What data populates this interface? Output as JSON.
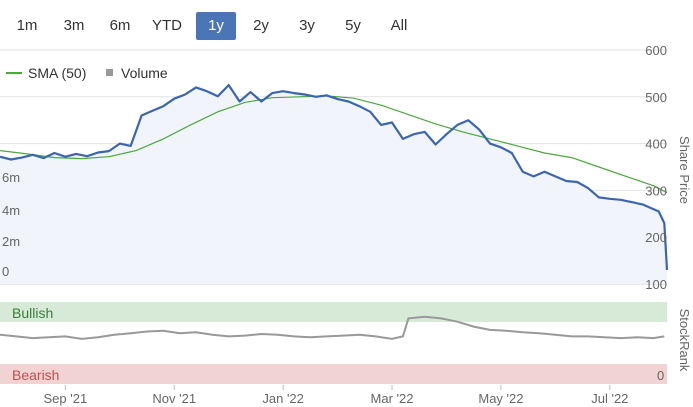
{
  "range_buttons": [
    {
      "label": "1m",
      "active": false
    },
    {
      "label": "3m",
      "active": false
    },
    {
      "label": "6m",
      "active": false
    },
    {
      "label": "YTD",
      "active": false
    },
    {
      "label": "1y",
      "active": true
    },
    {
      "label": "2y",
      "active": false
    },
    {
      "label": "3y",
      "active": false
    },
    {
      "label": "5y",
      "active": false
    },
    {
      "label": "All",
      "active": false
    }
  ],
  "colors": {
    "price": "#3a66b0",
    "price_fill": "#f1f4fa",
    "sma": "#4aa83c",
    "volume": "#c4c4c4",
    "stockrank": "#999999",
    "bullish_band": "#d7ead7",
    "bearish_band": "#f2d3d3",
    "active_button": "#4a76b8"
  },
  "chart_data": [
    {
      "type": "line",
      "title": "",
      "y_right_label": "Share Price",
      "y_right_ticks": [
        600,
        500,
        400,
        300,
        200,
        100
      ],
      "y_left_label": "",
      "y_left_ticks": [
        "0",
        "2m",
        "4m",
        "6m"
      ],
      "ylim": [
        100,
        600
      ],
      "x_ticks": [
        "Sep '21",
        "Nov '21",
        "Jan '22",
        "Mar '22",
        "May '22",
        "Jul '22"
      ],
      "x_tick_positions": [
        1.2,
        3.2,
        5.2,
        7.2,
        9.2,
        11.2
      ],
      "xlim": [
        0,
        12.25
      ],
      "grid": true,
      "legend": {
        "placement": "top-left",
        "entries": [
          "SMA (50)",
          "Volume"
        ]
      },
      "series": [
        {
          "name": "",
          "role": "price",
          "x": [
            0,
            0.2,
            0.4,
            0.6,
            0.8,
            1,
            1.2,
            1.4,
            1.6,
            1.8,
            2,
            2.2,
            2.4,
            2.6,
            2.8,
            3,
            3.2,
            3.4,
            3.6,
            3.8,
            4,
            4.2,
            4.4,
            4.6,
            4.8,
            5,
            5.2,
            5.4,
            5.6,
            5.8,
            6,
            6.2,
            6.4,
            6.6,
            6.8,
            7,
            7.2,
            7.4,
            7.6,
            7.8,
            8,
            8.2,
            8.4,
            8.6,
            8.8,
            9,
            9.2,
            9.4,
            9.6,
            9.8,
            10,
            10.2,
            10.4,
            10.6,
            10.8,
            11,
            11.2,
            11.4,
            11.6,
            11.8,
            12,
            12.1,
            12.2,
            12.25
          ],
          "values": [
            372,
            366,
            370,
            376,
            369,
            380,
            372,
            378,
            373,
            381,
            384,
            400,
            395,
            460,
            470,
            480,
            496,
            505,
            520,
            512,
            501,
            525,
            490,
            510,
            490,
            508,
            512,
            508,
            505,
            500,
            503,
            495,
            490,
            480,
            468,
            440,
            445,
            410,
            420,
            425,
            398,
            420,
            440,
            450,
            430,
            400,
            392,
            380,
            340,
            330,
            340,
            330,
            320,
            318,
            305,
            285,
            282,
            280,
            275,
            270,
            260,
            255,
            230,
            130
          ]
        },
        {
          "name": "SMA (50)",
          "role": "sma",
          "x": [
            0,
            0.5,
            1,
            1.5,
            2,
            2.5,
            3,
            3.5,
            4,
            4.5,
            5,
            5.5,
            6,
            6.5,
            7,
            7.5,
            8,
            8.5,
            9,
            9.5,
            10,
            10.5,
            11,
            11.5,
            12,
            12.25
          ],
          "values": [
            385,
            378,
            370,
            368,
            372,
            385,
            410,
            440,
            468,
            488,
            498,
            500,
            502,
            497,
            482,
            462,
            442,
            425,
            410,
            395,
            380,
            370,
            350,
            330,
            310,
            295
          ]
        },
        {
          "name": "Volume",
          "role": "volume",
          "unit": "shares",
          "x": [
            0.1,
            0.4,
            0.7,
            1.0,
            1.3,
            1.6,
            1.9,
            2.2,
            2.5,
            2.6,
            2.8,
            3.0,
            3.2,
            3.4,
            3.5,
            3.7,
            3.9,
            4.2,
            4.5,
            4.8,
            5.0,
            5.2,
            5.5,
            5.8,
            6.1,
            6.4,
            6.7,
            7.0,
            7.3,
            7.6,
            7.9,
            8.2,
            8.5,
            8.8,
            9.1,
            9.4,
            9.7,
            10.0,
            10.3,
            10.6,
            10.9,
            11.2,
            11.5,
            11.8,
            12.0,
            12.1,
            12.2
          ],
          "values": [
            100000,
            150000,
            120000,
            200000,
            180000,
            150000,
            250000,
            200000,
            300000,
            250000,
            400000,
            700000,
            650000,
            800000,
            900000,
            750000,
            600000,
            250000,
            250000,
            1500000,
            200000,
            1800000,
            200000,
            150000,
            200000,
            300000,
            200000,
            250000,
            200000,
            150000,
            200000,
            250000,
            200000,
            150000,
            200000,
            250000,
            200000,
            250000,
            150000,
            200000,
            300000,
            250000,
            200000,
            350000,
            400000,
            300000,
            200000
          ]
        }
      ]
    },
    {
      "type": "line",
      "title": "",
      "y_right_label": "StockRank",
      "y_right_ticks": [
        0
      ],
      "bands": {
        "top": "Bullish",
        "bottom": "Bearish"
      },
      "ylim": [
        0,
        100
      ],
      "xlim": [
        0,
        12.25
      ],
      "series": [
        {
          "name": "",
          "role": "stockrank",
          "x": [
            0,
            0.3,
            0.6,
            0.9,
            1.2,
            1.5,
            1.8,
            2.1,
            2.4,
            2.7,
            3.0,
            3.3,
            3.6,
            3.9,
            4.2,
            4.5,
            4.8,
            5.1,
            5.4,
            5.7,
            6.0,
            6.3,
            6.6,
            6.9,
            7.2,
            7.4,
            7.5,
            7.8,
            8.1,
            8.4,
            8.7,
            9.0,
            9.3,
            9.6,
            9.9,
            10.2,
            10.5,
            10.8,
            11.1,
            11.4,
            11.7,
            12.0,
            12.2
          ],
          "values": [
            60,
            58,
            56,
            57,
            58,
            55,
            57,
            60,
            62,
            64,
            65,
            62,
            63,
            60,
            58,
            59,
            61,
            60,
            58,
            57,
            58,
            59,
            60,
            58,
            55,
            58,
            80,
            82,
            80,
            76,
            70,
            66,
            65,
            63,
            62,
            60,
            58,
            58,
            57,
            56,
            57,
            56,
            58
          ]
        }
      ]
    }
  ]
}
